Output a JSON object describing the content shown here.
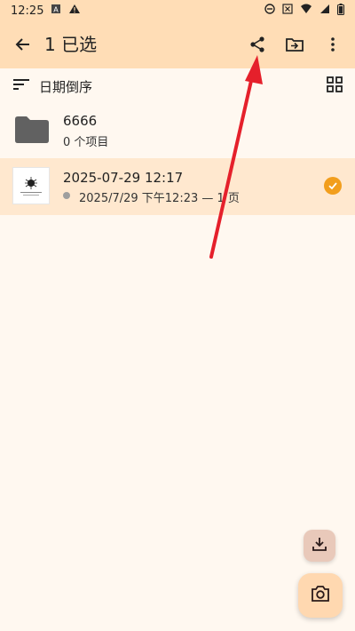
{
  "status_bar": {
    "time": "12:25",
    "icons": [
      "notification-a-icon",
      "warning-icon",
      "dnd-icon",
      "close-box-icon",
      "wifi-icon",
      "signal-icon",
      "battery-icon"
    ]
  },
  "app_bar": {
    "title": "1 已选",
    "actions": [
      "share-icon",
      "move-to-folder-icon",
      "more-vert-icon"
    ],
    "colors": {
      "bar": "#FFDDB6"
    }
  },
  "sort_bar": {
    "label": "日期倒序"
  },
  "items": [
    {
      "type": "folder",
      "title": "6666",
      "subtitle": "0 个项目"
    },
    {
      "type": "document",
      "title": "2025-07-29 12:17",
      "subtitle": "2025/7/29 下午12:23 — 1 页",
      "selected": true
    }
  ],
  "fabs": [
    "download-icon",
    "camera-icon"
  ],
  "annotation": {
    "type": "arrow",
    "color": "#E5202B",
    "points_to": "share-icon"
  },
  "colors": {
    "accent": "#F29E1D",
    "background": "#FFF8F0",
    "selected_row": "#FFE8CF"
  }
}
